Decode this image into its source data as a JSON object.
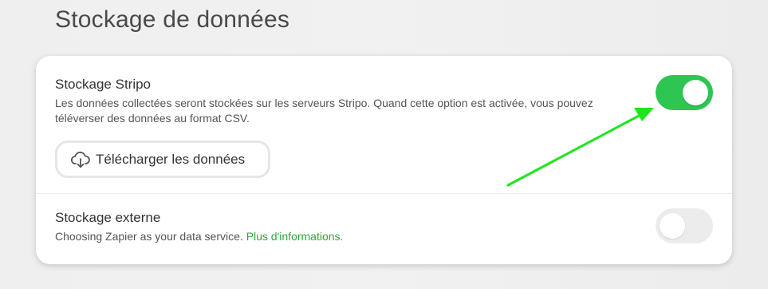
{
  "section": {
    "title": "Stockage de données"
  },
  "stripo_storage": {
    "title": "Stockage Stripo",
    "description": "Les données collectées seront stockées sur les serveurs Stripo. Quand cette option est activée, vous pouvez téléverser des données au format CSV.",
    "enabled": true,
    "download_label": "Télécharger les données",
    "download_icon": "cloud-download-icon"
  },
  "external_storage": {
    "title": "Stockage externe",
    "description": "Choosing Zapier as your data service.",
    "link_label": "Plus d'informations.",
    "enabled": false
  },
  "colors": {
    "toggle_on": "#2fc552",
    "toggle_off": "#ececec",
    "link": "#2aa83c",
    "annotation_arrow": "#1ee61e"
  }
}
